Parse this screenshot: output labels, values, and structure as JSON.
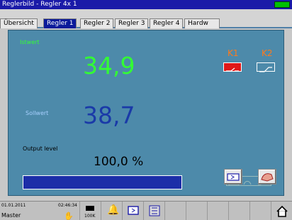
{
  "window": {
    "title": "Reglerbild - Regler 4x 1"
  },
  "tabs": [
    {
      "label": "Übersicht"
    },
    {
      "label": "Regler 1"
    },
    {
      "label": "Regler 2"
    },
    {
      "label": "Regler 3"
    },
    {
      "label": "Regler 4"
    },
    {
      "label": "Hardw"
    }
  ],
  "panel": {
    "istwert_label": "Istwert",
    "istwert_value": "34,9",
    "sollwert_label": "Sollwert",
    "sollwert_value": "38,7",
    "output_label": "Output level",
    "output_value": "100,0 %",
    "output_fraction": 1.0,
    "k1_label": "K1",
    "k2_label": "K2"
  },
  "colors": {
    "istwert": "#33ff33",
    "sollwert": "#1a3aa8",
    "k_labels": "#ff7a1a",
    "k1_active": "#e01818",
    "panel_bg": "#4d8aaa"
  },
  "statusbar": {
    "date": "01.01.2011",
    "time": "02:46:34",
    "user": "Master",
    "memory": "100K"
  }
}
